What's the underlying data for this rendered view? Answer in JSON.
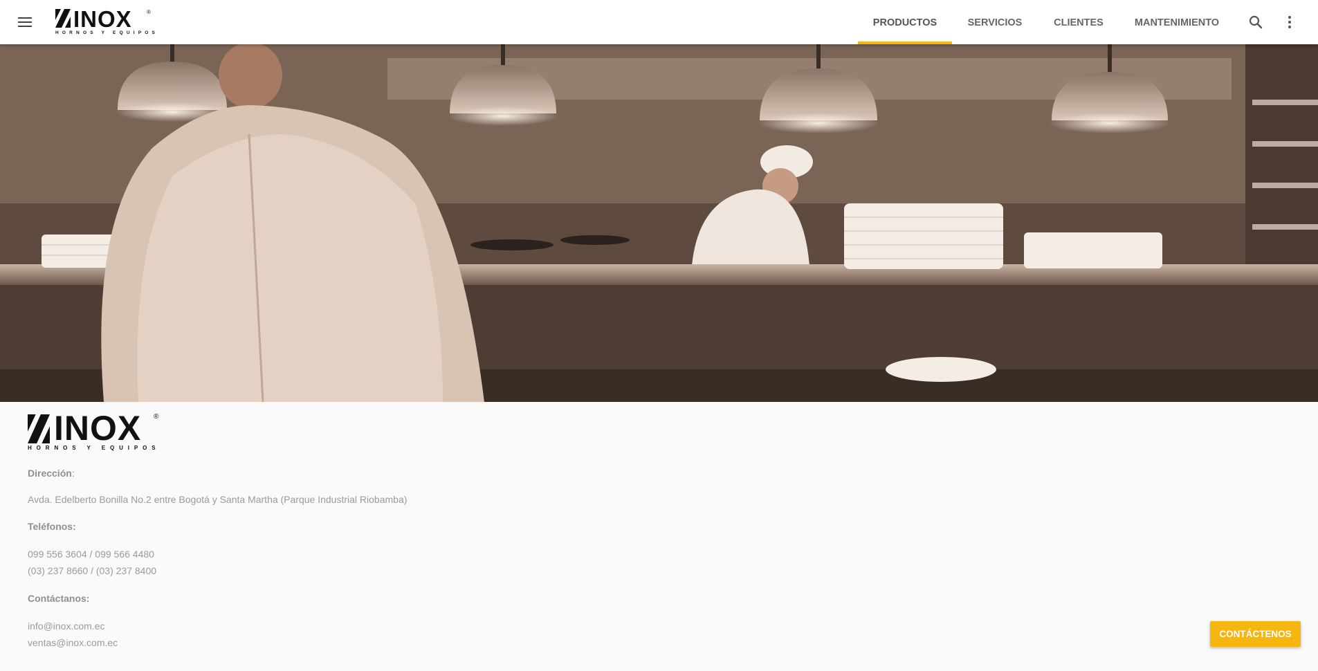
{
  "header": {
    "menu_icon": "hamburger-menu-icon",
    "logo": {
      "brand": "INOX",
      "registered": "®",
      "tagline": "HORNOS Y EQUIPOS"
    },
    "nav": [
      {
        "label": "PRODUCTOS",
        "active": true
      },
      {
        "label": "SERVICIOS",
        "active": false
      },
      {
        "label": "CLIENTES",
        "active": false
      },
      {
        "label": "MANTENIMIENTO",
        "active": false
      }
    ],
    "search_icon": "search-icon",
    "more_icon": "more-vert-icon"
  },
  "footer": {
    "logo": {
      "brand": "INOX",
      "registered": "®",
      "tagline": "HORNOS Y EQUIPOS"
    },
    "address_label": "Dirección",
    "address_colon": ":",
    "address": "Avda. Edelberto Bonilla No.2 entre Bogotá y Santa Martha (Parque Industrial Riobamba)",
    "phones_label": "Teléfonos:",
    "phones": [
      "099 556 3604 / 099 566 4480",
      "(03) 237 8660 / (03) 237 8400"
    ],
    "contact_label": "Contáctanos:",
    "emails": [
      "info@inox.com.ec",
      "ventas@inox.com.ec"
    ]
  },
  "cta_label": "CONTÁCTENOS",
  "colors": {
    "accent": "#f5b70f",
    "text_muted": "#9a9a9a",
    "header_bg": "#ffffff"
  }
}
